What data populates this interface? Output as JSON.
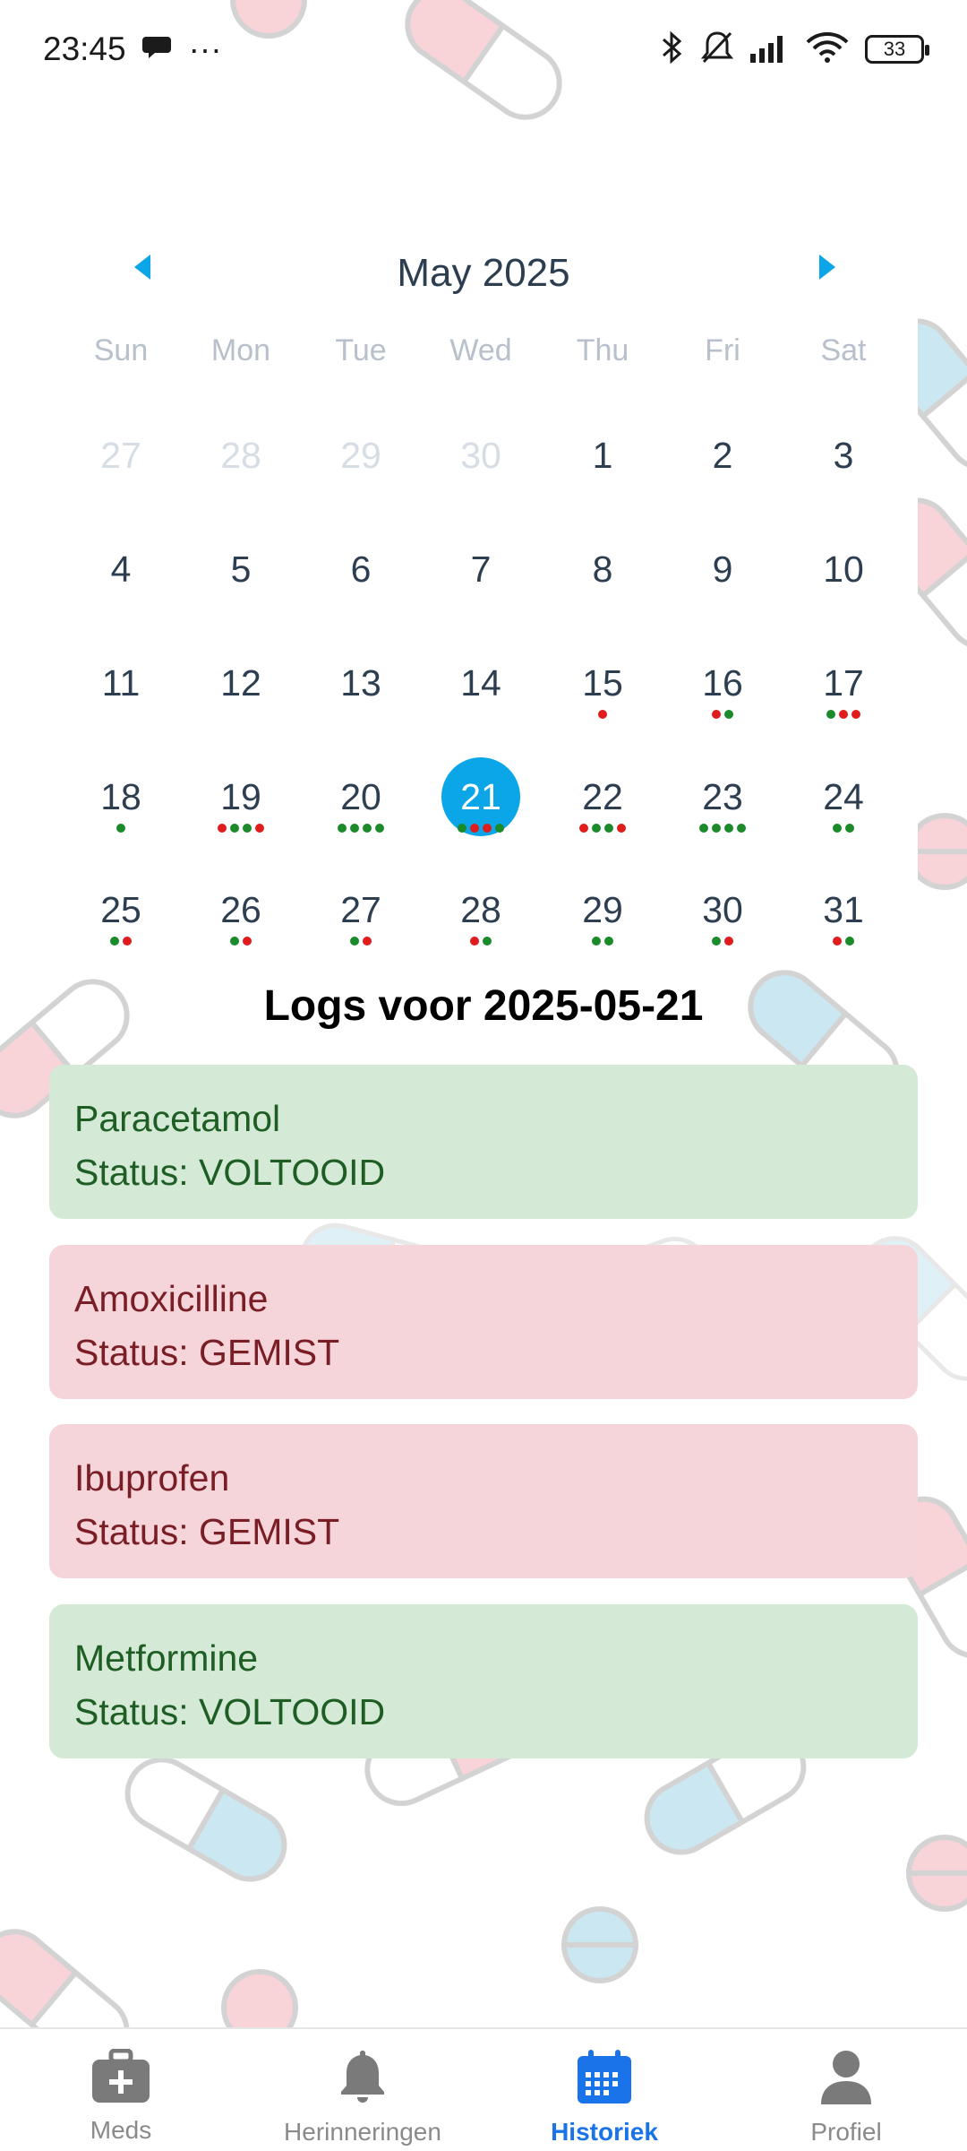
{
  "status_bar": {
    "time": "23:45",
    "more": "···",
    "battery": "33"
  },
  "calendar": {
    "month_title": "May 2025",
    "weekdays": [
      "Sun",
      "Mon",
      "Tue",
      "Wed",
      "Thu",
      "Fri",
      "Sat"
    ],
    "weeks": [
      [
        {
          "d": "27",
          "dim": true,
          "dots": ""
        },
        {
          "d": "28",
          "dim": true,
          "dots": ""
        },
        {
          "d": "29",
          "dim": true,
          "dots": ""
        },
        {
          "d": "30",
          "dim": true,
          "dots": ""
        },
        {
          "d": "1",
          "dots": ""
        },
        {
          "d": "2",
          "dots": ""
        },
        {
          "d": "3",
          "dots": ""
        }
      ],
      [
        {
          "d": "4",
          "dots": ""
        },
        {
          "d": "5",
          "dots": ""
        },
        {
          "d": "6",
          "dots": ""
        },
        {
          "d": "7",
          "dots": ""
        },
        {
          "d": "8",
          "dots": ""
        },
        {
          "d": "9",
          "dots": ""
        },
        {
          "d": "10",
          "dots": ""
        }
      ],
      [
        {
          "d": "11",
          "dots": ""
        },
        {
          "d": "12",
          "dots": ""
        },
        {
          "d": "13",
          "dots": ""
        },
        {
          "d": "14",
          "dots": ""
        },
        {
          "d": "15",
          "dots": "r"
        },
        {
          "d": "16",
          "dots": "rg"
        },
        {
          "d": "17",
          "dots": "grr"
        }
      ],
      [
        {
          "d": "18",
          "dots": "g"
        },
        {
          "d": "19",
          "dots": "rggr"
        },
        {
          "d": "20",
          "dots": "gggg"
        },
        {
          "d": "21",
          "dots": "grrg",
          "sel": true
        },
        {
          "d": "22",
          "dots": "rggr"
        },
        {
          "d": "23",
          "dots": "gggg"
        },
        {
          "d": "24",
          "dots": "gg"
        }
      ],
      [
        {
          "d": "25",
          "dots": "gr"
        },
        {
          "d": "26",
          "dots": "gr"
        },
        {
          "d": "27",
          "dots": "gr"
        },
        {
          "d": "28",
          "dots": "rg"
        },
        {
          "d": "29",
          "dots": "gg"
        },
        {
          "d": "30",
          "dots": "gr"
        },
        {
          "d": "31",
          "dots": "rg"
        }
      ]
    ]
  },
  "colors": {
    "accent": "#0aa6e8",
    "taken": "#1a8a2a",
    "missed": "#e01c1c",
    "done_bg": "#d4ead6",
    "miss_bg": "#f6d5da",
    "nav_active": "#1a73e8"
  },
  "logs": {
    "title": "Logs voor 2025-05-21",
    "items": [
      {
        "name": "Paracetamol",
        "status": "Status: VOLTOOID",
        "state": "done"
      },
      {
        "name": "Amoxicilline",
        "status": "Status: GEMIST",
        "state": "miss"
      },
      {
        "name": "Ibuprofen",
        "status": "Status: GEMIST",
        "state": "miss"
      },
      {
        "name": "Metformine",
        "status": "Status: VOLTOOID",
        "state": "done"
      }
    ]
  },
  "nav": {
    "items": [
      {
        "label": "Meds",
        "icon": "medical-kit-icon"
      },
      {
        "label": "Herinneringen",
        "icon": "bell-icon"
      },
      {
        "label": "Historiek",
        "icon": "calendar-icon",
        "active": true
      },
      {
        "label": "Profiel",
        "icon": "person-icon"
      }
    ]
  }
}
